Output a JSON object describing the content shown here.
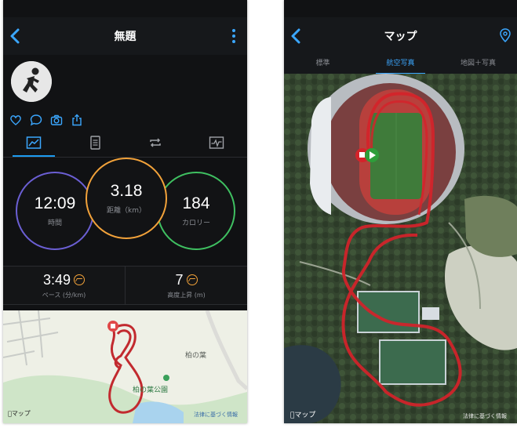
{
  "activity_screen": {
    "title": "無題",
    "stats": {
      "time": {
        "value": "12:09",
        "label": "時間"
      },
      "distance": {
        "value": "3.18",
        "label": "距離（km）"
      },
      "calories": {
        "value": "184",
        "label": "カロリー"
      },
      "pace": {
        "value": "3:49",
        "label": "ペース (分/km)"
      },
      "elevation": {
        "value": "7",
        "label": "高度上昇 (m)"
      }
    },
    "map": {
      "place_label_1": "柏の葉",
      "place_label_2": "柏の葉公園",
      "credit": "マップ",
      "legal": "法律に基づく情報"
    },
    "icons": [
      "back-icon",
      "more-icon",
      "heart-icon",
      "comment-icon",
      "camera-icon",
      "share-icon",
      "summary-tab-icon",
      "details-tab-icon",
      "laps-tab-icon",
      "chart-tab-icon"
    ]
  },
  "map_screen": {
    "title": "マップ",
    "tabs": [
      "標準",
      "航空写真",
      "地図＋写真"
    ],
    "active_tab": "航空写真",
    "credit": "マップ",
    "legal": "法律に基づく情報"
  },
  "colors": {
    "accent_blue": "#1d9bf0",
    "ring_time": "#6b5fd4",
    "ring_distance": "#f2a23a",
    "ring_calories": "#3fc061",
    "route": "#d4232a"
  }
}
